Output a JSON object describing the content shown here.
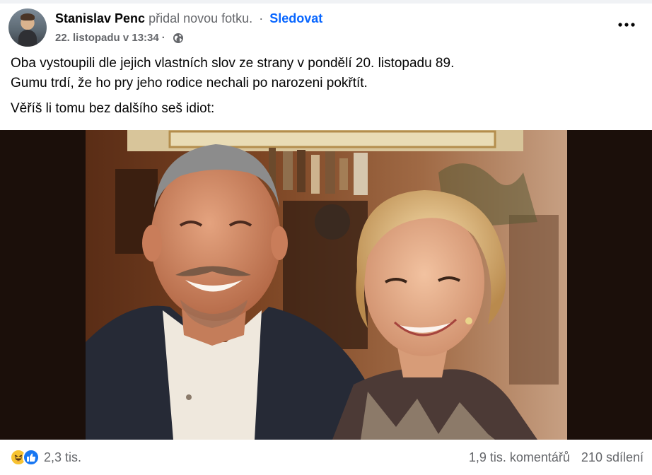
{
  "header": {
    "author": "Stanislav Penc",
    "action": "přidal novou fotku.",
    "separator": "·",
    "follow_label": "Sledovat",
    "date": "22. listopadu v 13:34",
    "date_separator": "·",
    "privacy_icon": "globe-icon",
    "more_icon": "more-options-icon"
  },
  "post_text": {
    "line1": "Oba vystoupili dle jejich vlastních slov ze strany v pondělí 20. listopadu 89.",
    "line2": "Gumu trdí, že ho pry jeho rodice nechali po narozeni pokřtít.",
    "line3": "Věříš li tomu bez dalšího seš idiot:"
  },
  "photo": {
    "description_icon": "post-photo"
  },
  "footer": {
    "reaction_icons": [
      "haha-reaction-icon",
      "like-reaction-icon"
    ],
    "reaction_count": "2,3 tis.",
    "comments": "1,9 tis. komentářů",
    "shares": "210 sdílení"
  },
  "colors": {
    "follow": "#0866ff",
    "secondary_text": "#65676b",
    "like_blue": "#1877f2",
    "haha_yellow": "#f7c331"
  }
}
